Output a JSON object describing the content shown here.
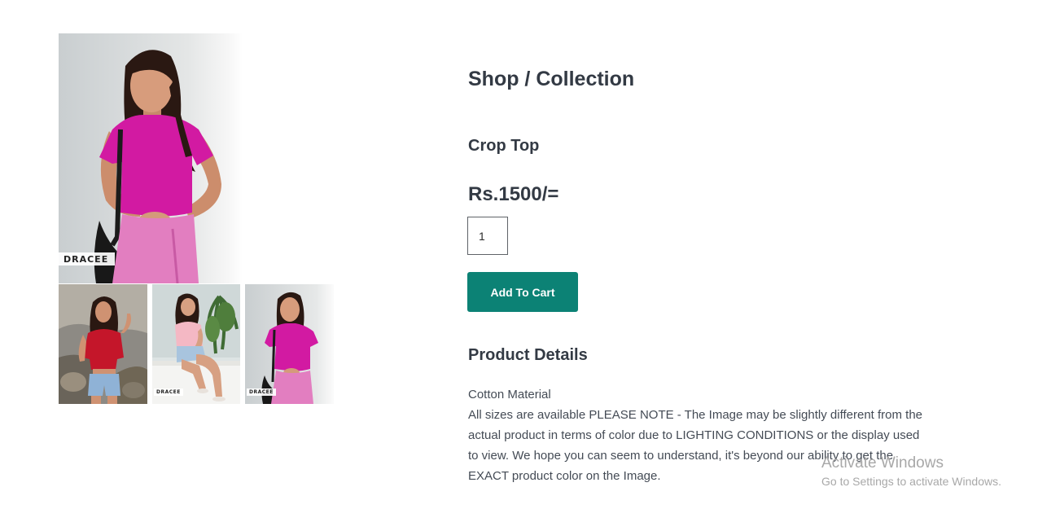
{
  "gallery": {
    "brand_tag": "DRACEE",
    "thumbnails": [
      {
        "icon": "model-red-top-photo"
      },
      {
        "icon": "model-pink-top-sitting-photo"
      },
      {
        "icon": "model-magenta-top-photo"
      }
    ],
    "main_photo_icon": "model-magenta-top-photo"
  },
  "product": {
    "breadcrumb": "Shop / Collection",
    "name": "Crop Top",
    "price": "Rs.1500/=",
    "quantity": "1",
    "add_to_cart_label": "Add To Cart",
    "details_heading": "Product Details",
    "details_lines": [
      "Cotton Material",
      "All sizes are available PLEASE NOTE - The Image may be slightly different from the actual product in terms of color due to LIGHTING CONDITIONS or the display used to view. We hope you can seem to understand, it's beyond our ability to get the EXACT product color on the Image."
    ]
  },
  "watermark": {
    "title": "Activate Windows",
    "subtitle": "Go to Settings to activate Windows."
  },
  "colors": {
    "accent": "#0c8275",
    "text": "#333a44",
    "magenta_top": "#d21aa2",
    "red_top": "#c4162a",
    "pink_top": "#f4b8c4"
  }
}
